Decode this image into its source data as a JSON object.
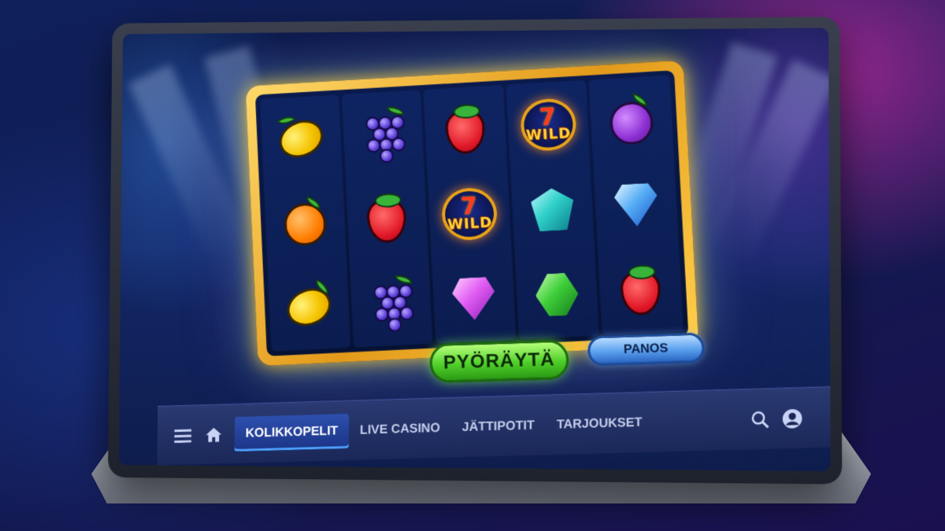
{
  "buttons": {
    "spin_label": "PYÖRÄYTÄ",
    "bet_label": "PANOS"
  },
  "nav": {
    "items": [
      {
        "label": "KOLIKKOPELIT",
        "active": true
      },
      {
        "label": "LIVE CASINO",
        "active": false
      },
      {
        "label": "JÄTTIPOTIT",
        "active": false
      },
      {
        "label": "TARJOUKSET",
        "active": false
      }
    ],
    "icons": [
      "menu-icon",
      "home-icon",
      "search-icon",
      "user-icon"
    ]
  },
  "reels": [
    [
      "lemon",
      "orange",
      "lemon"
    ],
    [
      "grapes",
      "strawberry",
      "grapes"
    ],
    [
      "strawberry",
      "wild",
      "pink-gem"
    ],
    [
      "wild",
      "teal-gem",
      "green-gem"
    ],
    [
      "plum",
      "blue-gem",
      "strawberry"
    ]
  ],
  "wild": {
    "seven": "7",
    "text": "WILD"
  },
  "colors": {
    "spin_button": "#4fcf2a",
    "bet_button": "#5aa0ee",
    "frame": "#e39a1a",
    "active_tab": "#2d4fae"
  }
}
